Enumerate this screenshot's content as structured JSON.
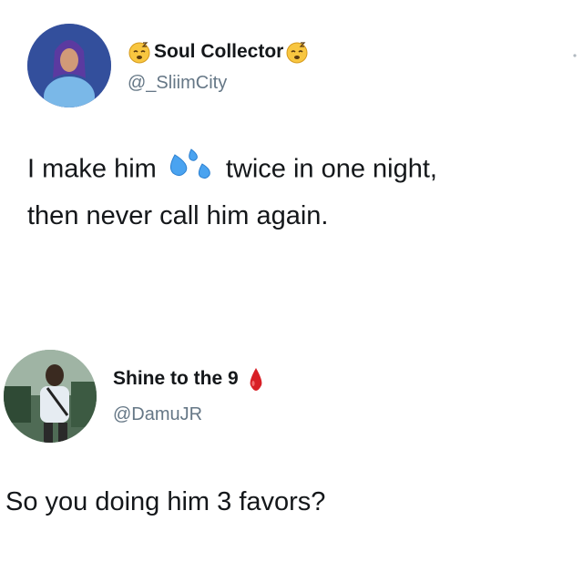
{
  "tweet": {
    "author": {
      "display_name": "Soul Collector",
      "handle": "@_SliimCity",
      "emoji_icon": "sleepy-face-icon"
    },
    "text_line1_before": "I make him",
    "text_emoji_icon": "sweat-droplets-icon",
    "text_line1_after": "twice in one night,",
    "text_line2": "then never call him again."
  },
  "reply": {
    "author": {
      "display_name": "Shine to the 9",
      "handle": "@DamuJR",
      "emoji_icon": "drop-of-blood-icon"
    },
    "text": "So you doing him 3 favors?"
  }
}
